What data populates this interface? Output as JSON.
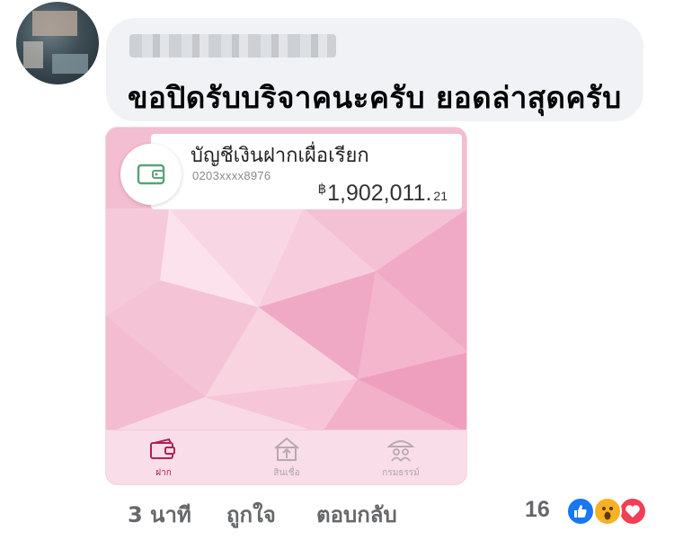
{
  "comment": {
    "text": "ขอปิดรับบริจาคนะครับ ยอดล่าสุดครับ"
  },
  "attachment": {
    "account_type": "บัญชีเงินฝากเผื่อเรียก",
    "account_number": "0203xxxx8976",
    "balance": {
      "currency": "฿",
      "main": "1,902,011.",
      "decimals": "21"
    },
    "tabs": [
      {
        "label": "ฝาก",
        "icon": "wallet-icon",
        "active": true
      },
      {
        "label": "สินเชื่อ",
        "icon": "house-arrow-icon",
        "active": false
      },
      {
        "label": "กรมธรรม์",
        "icon": "umbrella-family-icon",
        "active": false
      }
    ]
  },
  "actions": {
    "time": "3 นาที",
    "like": "ถูกใจ",
    "reply": "ตอบกลับ",
    "reaction_count": "16",
    "reactions": [
      "like-icon",
      "wow-icon",
      "love-icon"
    ]
  },
  "colors": {
    "bubble": "#f0f2f5",
    "card_pink": "#f2b8cf",
    "tab_active": "#b0224e",
    "like_blue": "#1877f2",
    "love_red": "#f33e58",
    "wow_yellow": "#f7b125"
  }
}
